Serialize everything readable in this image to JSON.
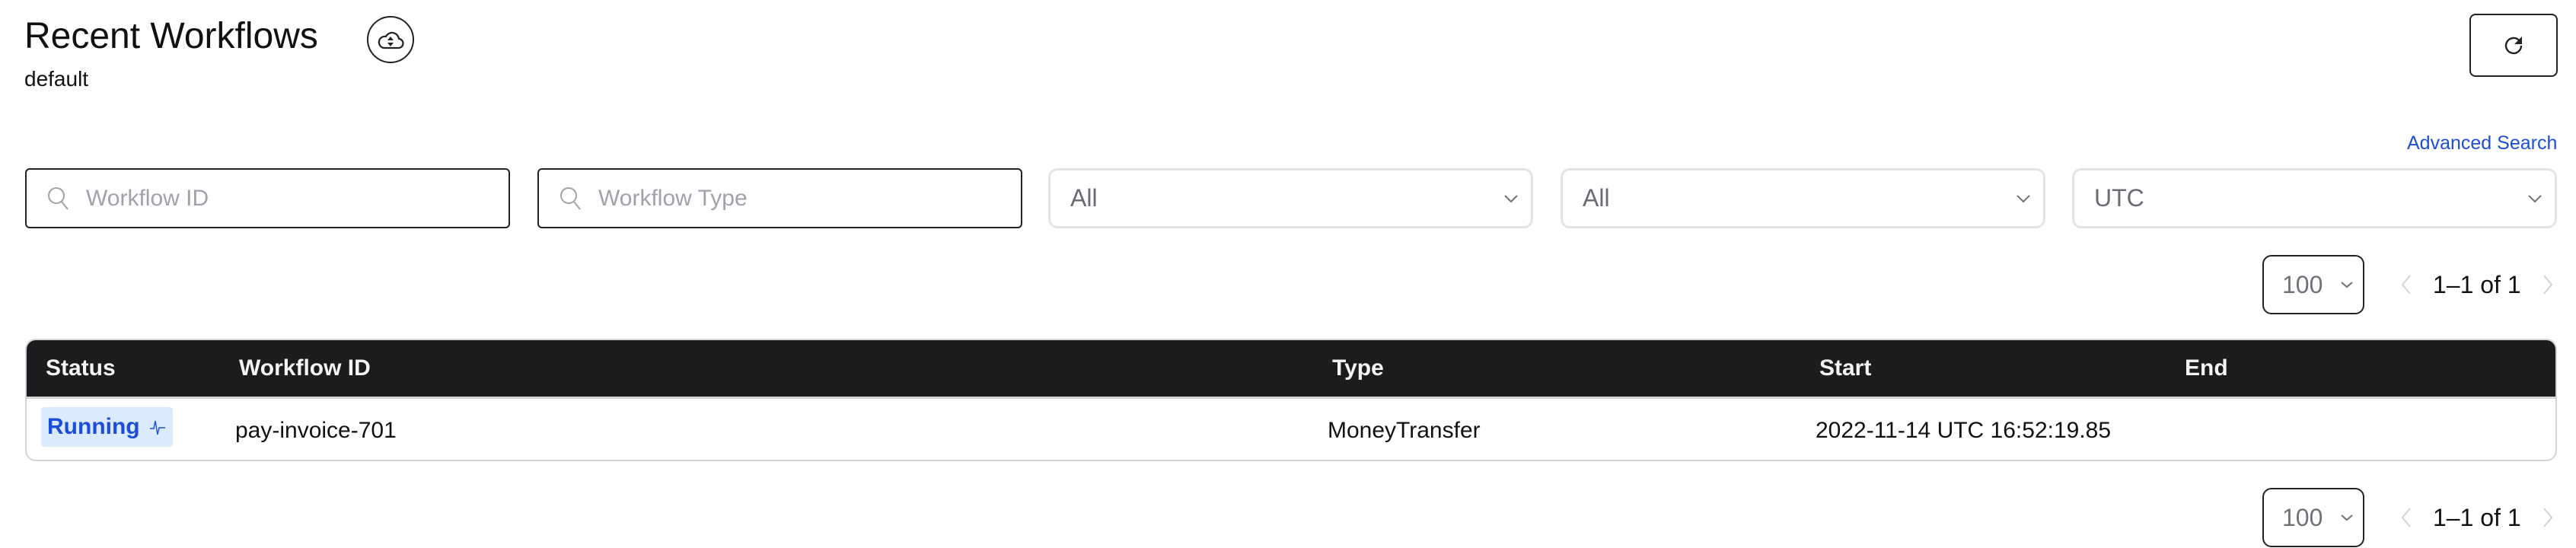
{
  "header": {
    "title": "Recent Workflows",
    "namespace": "default",
    "cloud_icon": "cloud-sort-icon",
    "refresh_icon": "refresh-icon",
    "advanced_search_label": "Advanced Search"
  },
  "filters": {
    "workflow_id": {
      "placeholder": "Workflow ID",
      "value": "",
      "icon": "search-icon"
    },
    "workflow_type": {
      "placeholder": "Workflow Type",
      "value": "",
      "icon": "search-icon"
    },
    "execution_status": {
      "selected": "All"
    },
    "time_range": {
      "selected": "All"
    },
    "timezone": {
      "selected": "UTC"
    }
  },
  "pagination": {
    "page_size": "100",
    "range_text": "1–1 of 1"
  },
  "table": {
    "columns": [
      "Status",
      "Workflow ID",
      "Type",
      "Start",
      "End"
    ],
    "rows": [
      {
        "status": "Running",
        "status_icon": "heartbeat-icon",
        "workflow_id": "pay-invoice-701",
        "type": "MoneyTransfer",
        "start": "2022-11-14 UTC 16:52:19.85",
        "end": ""
      }
    ]
  },
  "colors": {
    "accent": "#1d4ed8",
    "badge_bg": "#dbeafe",
    "table_header_bg": "#1c1c1e"
  }
}
